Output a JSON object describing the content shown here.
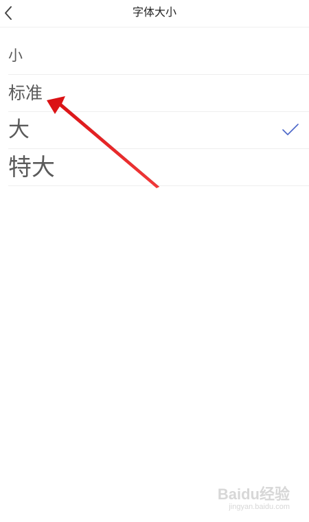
{
  "header": {
    "title": "字体大小",
    "back_icon": "chevron-left-icon"
  },
  "options": [
    {
      "label": "小",
      "selected": false
    },
    {
      "label": "标准",
      "selected": false
    },
    {
      "label": "大",
      "selected": true
    },
    {
      "label": "特大",
      "selected": false
    }
  ],
  "selected_icon": "checkmark-icon",
  "colors": {
    "check": "#4a66c8",
    "annotation_arrow": "#e8171a",
    "text": "#5a5a5a"
  },
  "watermark": {
    "logo": "Baidu经验",
    "url": "jingyan.baidu.com"
  }
}
